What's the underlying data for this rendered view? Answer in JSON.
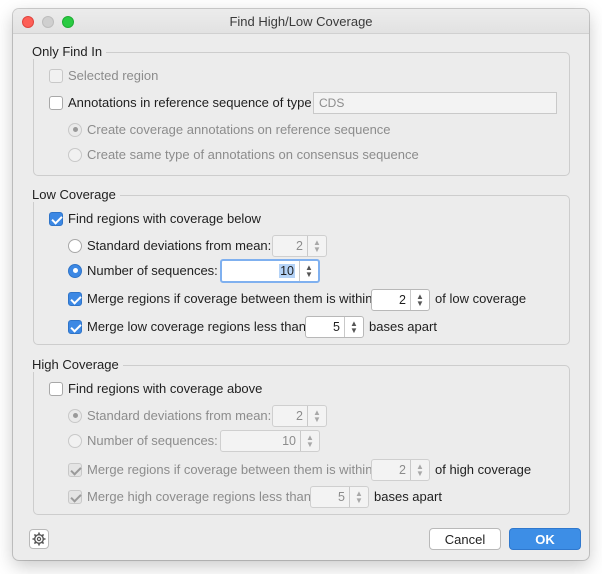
{
  "window": {
    "title": "Find High/Low Coverage"
  },
  "only_find_in": {
    "title": "Only Find In",
    "selected_region": {
      "label": "Selected region",
      "checked": false,
      "enabled": false
    },
    "annotations": {
      "label": "Annotations in reference sequence of type",
      "checked": false,
      "type_value": "CDS"
    },
    "radio_reference": {
      "label": "Create coverage annotations on reference sequence",
      "selected": true,
      "enabled": false
    },
    "radio_consensus": {
      "label": "Create same type of annotations on consensus sequence",
      "selected": false,
      "enabled": false
    }
  },
  "low_coverage": {
    "title": "Low Coverage",
    "find": {
      "label": "Find regions with coverage below",
      "checked": true
    },
    "std_dev": {
      "label": "Standard deviations from mean:",
      "value": "2",
      "selected": false
    },
    "num_seq": {
      "label": "Number of sequences:",
      "value": "10",
      "selected": true
    },
    "merge_within": {
      "label": "Merge regions if coverage between them is within",
      "value": "2",
      "suffix": "of low coverage",
      "checked": true
    },
    "merge_less": {
      "label": "Merge low coverage regions less than",
      "value": "5",
      "suffix": "bases apart",
      "checked": true
    }
  },
  "high_coverage": {
    "title": "High Coverage",
    "find": {
      "label": "Find regions with coverage above",
      "checked": false
    },
    "std_dev": {
      "label": "Standard deviations from mean:",
      "value": "2",
      "selected": true
    },
    "num_seq": {
      "label": "Number of sequences:",
      "value": "10",
      "selected": false
    },
    "merge_within": {
      "label": "Merge regions if coverage between them is within",
      "value": "2",
      "suffix": "of high coverage",
      "checked": true
    },
    "merge_less": {
      "label": "Merge high coverage regions less than",
      "value": "5",
      "suffix": "bases apart",
      "checked": true
    }
  },
  "buttons": {
    "cancel": "Cancel",
    "ok": "OK",
    "settings_icon": "gear-icon"
  },
  "colors": {
    "accent": "#3c88e4",
    "window_bg": "#ececec"
  }
}
